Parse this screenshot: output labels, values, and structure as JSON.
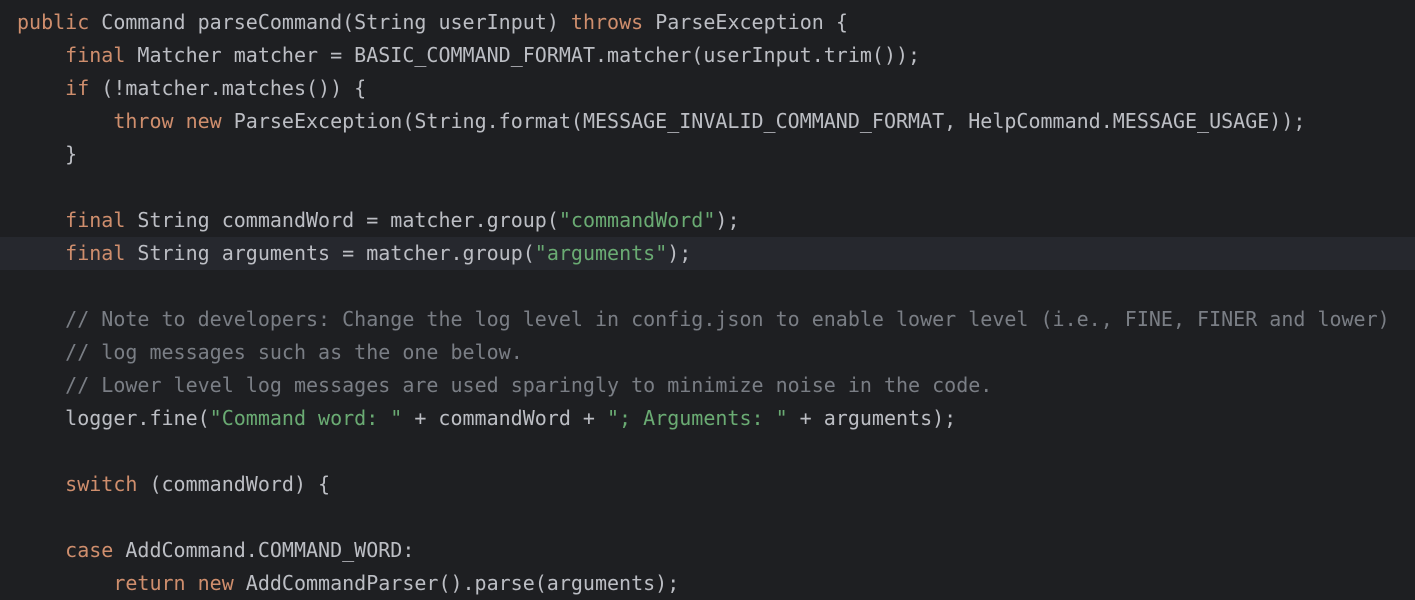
{
  "editor": {
    "language": "Java",
    "current_line_index": 7,
    "colors": {
      "background": "#1e1f22",
      "current_line": "#26282e",
      "text": "#bcbec4",
      "keyword": "#cf8e6d",
      "string": "#6aab73",
      "comment": "#7a7e85"
    },
    "lines": [
      [
        {
          "t": "kw",
          "v": "public "
        },
        {
          "t": "plain",
          "v": "Command parseCommand(String userInput) "
        },
        {
          "t": "kw",
          "v": "throws "
        },
        {
          "t": "plain",
          "v": "ParseException {"
        }
      ],
      [
        {
          "t": "plain",
          "v": "    "
        },
        {
          "t": "kw",
          "v": "final "
        },
        {
          "t": "plain",
          "v": "Matcher matcher = BASIC_COMMAND_FORMAT.matcher(userInput.trim());"
        }
      ],
      [
        {
          "t": "plain",
          "v": "    "
        },
        {
          "t": "kw",
          "v": "if "
        },
        {
          "t": "plain",
          "v": "(!matcher.matches()) {"
        }
      ],
      [
        {
          "t": "plain",
          "v": "        "
        },
        {
          "t": "kw",
          "v": "throw new "
        },
        {
          "t": "plain",
          "v": "ParseException(String.format(MESSAGE_INVALID_COMMAND_FORMAT, HelpCommand.MESSAGE_USAGE));"
        }
      ],
      [
        {
          "t": "plain",
          "v": "    }"
        }
      ],
      [],
      [
        {
          "t": "plain",
          "v": "    "
        },
        {
          "t": "kw",
          "v": "final "
        },
        {
          "t": "plain",
          "v": "String commandWord = matcher.group("
        },
        {
          "t": "str",
          "v": "\"commandWord\""
        },
        {
          "t": "plain",
          "v": ");"
        }
      ],
      [
        {
          "t": "plain",
          "v": "    "
        },
        {
          "t": "kw",
          "v": "final "
        },
        {
          "t": "plain",
          "v": "String arguments = matcher.group("
        },
        {
          "t": "str",
          "v": "\"arguments\""
        },
        {
          "t": "plain",
          "v": ");"
        }
      ],
      [],
      [
        {
          "t": "plain",
          "v": "    "
        },
        {
          "t": "cmt",
          "v": "// Note to developers: Change the log level in config.json to enable lower level (i.e., FINE, FINER and lower)"
        }
      ],
      [
        {
          "t": "plain",
          "v": "    "
        },
        {
          "t": "cmt",
          "v": "// log messages such as the one below."
        }
      ],
      [
        {
          "t": "plain",
          "v": "    "
        },
        {
          "t": "cmt",
          "v": "// Lower level log messages are used sparingly to minimize noise in the code."
        }
      ],
      [
        {
          "t": "plain",
          "v": "    logger.fine("
        },
        {
          "t": "str",
          "v": "\"Command word: \""
        },
        {
          "t": "plain",
          "v": " + commandWord + "
        },
        {
          "t": "str",
          "v": "\"; Arguments: \""
        },
        {
          "t": "plain",
          "v": " + arguments);"
        }
      ],
      [],
      [
        {
          "t": "plain",
          "v": "    "
        },
        {
          "t": "kw",
          "v": "switch "
        },
        {
          "t": "plain",
          "v": "(commandWord) {"
        }
      ],
      [],
      [
        {
          "t": "plain",
          "v": "    "
        },
        {
          "t": "kw",
          "v": "case "
        },
        {
          "t": "plain",
          "v": "AddCommand.COMMAND_WORD:"
        }
      ],
      [
        {
          "t": "plain",
          "v": "        "
        },
        {
          "t": "kw",
          "v": "return new "
        },
        {
          "t": "plain",
          "v": "AddCommandParser().parse(arguments);"
        }
      ]
    ]
  }
}
